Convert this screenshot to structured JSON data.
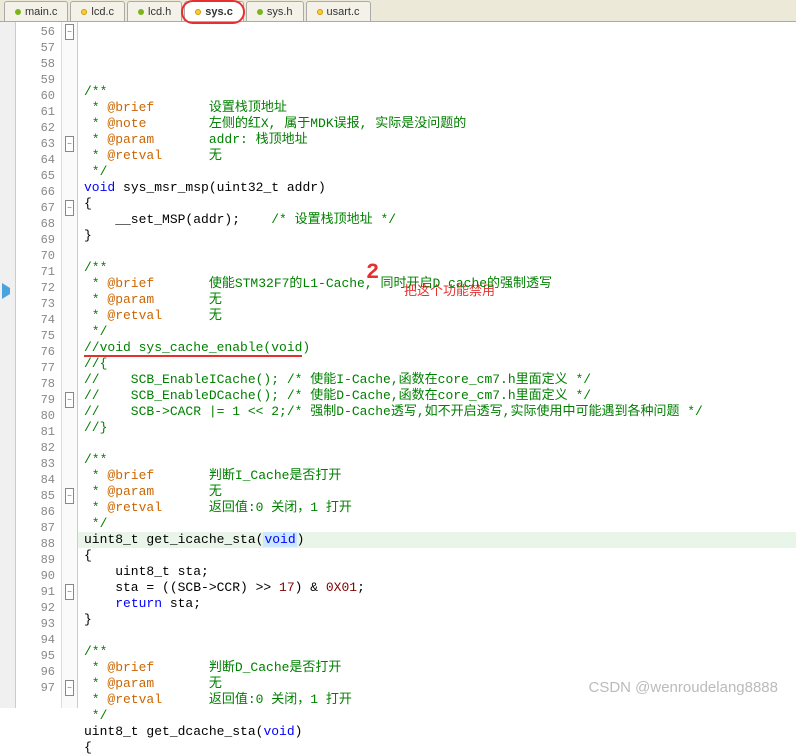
{
  "tabs": [
    {
      "label": "main.c",
      "icon": "green",
      "active": false
    },
    {
      "label": "lcd.c",
      "icon": "yellow",
      "active": false
    },
    {
      "label": "lcd.h",
      "icon": "green",
      "active": false
    },
    {
      "label": "sys.c",
      "icon": "yellow",
      "active": true,
      "circled": true
    },
    {
      "label": "sys.h",
      "icon": "green",
      "active": false
    },
    {
      "label": "usart.c",
      "icon": "yellow",
      "active": false
    }
  ],
  "annotations": {
    "num2": "2",
    "disable_text": "把这个功能禁用"
  },
  "watermark": "CSDN @wenroudelang8888",
  "lines": [
    {
      "n": 56,
      "fold": "minus",
      "seg": [
        {
          "c": "cmt",
          "t": "/**"
        }
      ]
    },
    {
      "n": 57,
      "seg": [
        {
          "c": "cmt",
          "t": " * "
        },
        {
          "c": "doc-tag",
          "t": "@brief"
        },
        {
          "c": "cmt",
          "t": "       设置栈顶地址"
        }
      ]
    },
    {
      "n": 58,
      "seg": [
        {
          "c": "cmt",
          "t": " * "
        },
        {
          "c": "doc-tag",
          "t": "@note"
        },
        {
          "c": "cmt",
          "t": "        左侧的红X, 属于MDK误报, 实际是没问题的"
        }
      ]
    },
    {
      "n": 59,
      "seg": [
        {
          "c": "cmt",
          "t": " * "
        },
        {
          "c": "doc-tag",
          "t": "@param"
        },
        {
          "c": "cmt",
          "t": "       addr: 栈顶地址"
        }
      ]
    },
    {
      "n": 60,
      "seg": [
        {
          "c": "cmt",
          "t": " * "
        },
        {
          "c": "doc-tag",
          "t": "@retval"
        },
        {
          "c": "cmt",
          "t": "      无"
        }
      ]
    },
    {
      "n": 61,
      "seg": [
        {
          "c": "cmt",
          "t": " */"
        }
      ]
    },
    {
      "n": 62,
      "seg": [
        {
          "c": "kw",
          "t": "void"
        },
        {
          "t": " sys_msr_msp(uint32_t addr)"
        }
      ]
    },
    {
      "n": 63,
      "fold": "minus",
      "seg": [
        {
          "t": "{"
        }
      ]
    },
    {
      "n": 64,
      "seg": [
        {
          "t": "    __set_MSP(addr);    "
        },
        {
          "c": "cmt",
          "t": "/* 设置栈顶地址 */"
        }
      ]
    },
    {
      "n": 65,
      "seg": [
        {
          "t": "}"
        }
      ]
    },
    {
      "n": 66,
      "seg": [
        {
          "t": ""
        }
      ]
    },
    {
      "n": 67,
      "fold": "minus",
      "seg": [
        {
          "c": "cmt",
          "t": "/**"
        }
      ]
    },
    {
      "n": 68,
      "seg": [
        {
          "c": "cmt",
          "t": " * "
        },
        {
          "c": "doc-tag",
          "t": "@brief"
        },
        {
          "c": "cmt",
          "t": "       使能STM32F7的L1-Cache, 同时开启D cache的强制透写"
        }
      ]
    },
    {
      "n": 69,
      "seg": [
        {
          "c": "cmt",
          "t": " * "
        },
        {
          "c": "doc-tag",
          "t": "@param"
        },
        {
          "c": "cmt",
          "t": "       无"
        }
      ]
    },
    {
      "n": 70,
      "seg": [
        {
          "c": "cmt",
          "t": " * "
        },
        {
          "c": "doc-tag",
          "t": "@retval"
        },
        {
          "c": "cmt",
          "t": "      无"
        }
      ]
    },
    {
      "n": 71,
      "seg": [
        {
          "c": "cmt",
          "t": " */"
        }
      ]
    },
    {
      "n": 72,
      "bp": true,
      "redline": true,
      "seg": [
        {
          "c": "cmt2",
          "t": "//void sys_cache_enable(void)"
        }
      ]
    },
    {
      "n": 73,
      "seg": [
        {
          "c": "cmt2",
          "t": "//{"
        }
      ]
    },
    {
      "n": 74,
      "seg": [
        {
          "c": "cmt2",
          "t": "//    SCB_EnableICache(); /* 使能I-Cache,函数在core_cm7.h里面定义 */"
        }
      ]
    },
    {
      "n": 75,
      "seg": [
        {
          "c": "cmt2",
          "t": "//    SCB_EnableDCache(); /* 使能D-Cache,函数在core_cm7.h里面定义 */"
        }
      ]
    },
    {
      "n": 76,
      "seg": [
        {
          "c": "cmt2",
          "t": "//    SCB->CACR |= 1 << 2;/* 强制D-Cache透写,如不开启透写,实际使用中可能遇到各种问题 */"
        }
      ]
    },
    {
      "n": 77,
      "seg": [
        {
          "c": "cmt2",
          "t": "//}"
        }
      ]
    },
    {
      "n": 78,
      "seg": [
        {
          "t": ""
        }
      ]
    },
    {
      "n": 79,
      "fold": "minus",
      "seg": [
        {
          "c": "cmt",
          "t": "/**"
        }
      ]
    },
    {
      "n": 80,
      "seg": [
        {
          "c": "cmt",
          "t": " * "
        },
        {
          "c": "doc-tag",
          "t": "@brief"
        },
        {
          "c": "cmt",
          "t": "       判断I_Cache是否打开"
        }
      ]
    },
    {
      "n": 81,
      "seg": [
        {
          "c": "cmt",
          "t": " * "
        },
        {
          "c": "doc-tag",
          "t": "@param"
        },
        {
          "c": "cmt",
          "t": "       无"
        }
      ]
    },
    {
      "n": 82,
      "seg": [
        {
          "c": "cmt",
          "t": " * "
        },
        {
          "c": "doc-tag",
          "t": "@retval"
        },
        {
          "c": "cmt",
          "t": "      返回值:0 关闭，1 打开"
        }
      ]
    },
    {
      "n": 83,
      "seg": [
        {
          "c": "cmt",
          "t": " */"
        }
      ]
    },
    {
      "n": 84,
      "hl": true,
      "seg": [
        {
          "t": "uint8_t get_icache_sta"
        },
        {
          "t": "("
        },
        {
          "c": "kw void-hl",
          "t": "void"
        },
        {
          "t": ")"
        }
      ]
    },
    {
      "n": 85,
      "fold": "minus",
      "seg": [
        {
          "t": "{"
        }
      ]
    },
    {
      "n": 86,
      "seg": [
        {
          "t": "    uint8_t sta;"
        }
      ]
    },
    {
      "n": 87,
      "seg": [
        {
          "t": "    sta = ((SCB->CCR) >> "
        },
        {
          "c": "num",
          "t": "17"
        },
        {
          "t": ") & "
        },
        {
          "c": "num",
          "t": "0X01"
        },
        {
          "t": ";"
        }
      ]
    },
    {
      "n": 88,
      "seg": [
        {
          "t": "    "
        },
        {
          "c": "kw",
          "t": "return"
        },
        {
          "t": " sta;"
        }
      ]
    },
    {
      "n": 89,
      "seg": [
        {
          "t": "}"
        }
      ]
    },
    {
      "n": 90,
      "seg": [
        {
          "t": ""
        }
      ]
    },
    {
      "n": 91,
      "fold": "minus",
      "seg": [
        {
          "c": "cmt",
          "t": "/**"
        }
      ]
    },
    {
      "n": 92,
      "seg": [
        {
          "c": "cmt",
          "t": " * "
        },
        {
          "c": "doc-tag",
          "t": "@brief"
        },
        {
          "c": "cmt",
          "t": "       判断D_Cache是否打开"
        }
      ]
    },
    {
      "n": 93,
      "seg": [
        {
          "c": "cmt",
          "t": " * "
        },
        {
          "c": "doc-tag",
          "t": "@param"
        },
        {
          "c": "cmt",
          "t": "       无"
        }
      ]
    },
    {
      "n": 94,
      "seg": [
        {
          "c": "cmt",
          "t": " * "
        },
        {
          "c": "doc-tag",
          "t": "@retval"
        },
        {
          "c": "cmt",
          "t": "      返回值:0 关闭，1 打开"
        }
      ]
    },
    {
      "n": 95,
      "seg": [
        {
          "c": "cmt",
          "t": " */"
        }
      ]
    },
    {
      "n": 96,
      "seg": [
        {
          "t": "uint8_t get_dcache_sta("
        },
        {
          "c": "kw",
          "t": "void"
        },
        {
          "t": ")"
        }
      ]
    },
    {
      "n": 97,
      "fold": "minus",
      "seg": [
        {
          "t": "{"
        }
      ]
    }
  ]
}
